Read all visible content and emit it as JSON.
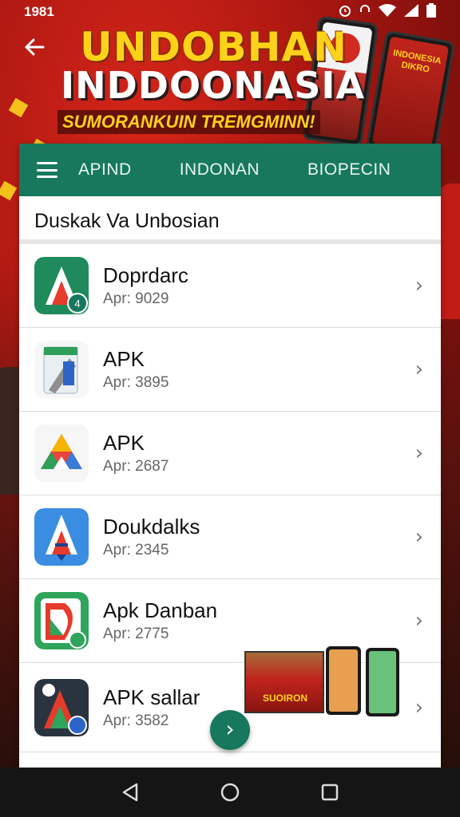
{
  "status_bar": {
    "time": "1981",
    "icons": [
      "alarm-icon",
      "headset-icon",
      "wifi-icon",
      "signal-icon",
      "battery-icon"
    ]
  },
  "banner": {
    "title_line1": "UNDOBHAN",
    "title_line2": "INDDOONASIA",
    "subtitle": "SUMORANKUIN TREMGMINN!",
    "promo_phone_text": "INDONESIA DIKRO"
  },
  "tabs": {
    "menu_icon": "hamburger-icon",
    "items": [
      "APIND",
      "INDONAN",
      "BIOPECIN"
    ]
  },
  "section": {
    "title": "Duskak Va Unbosian"
  },
  "apps": [
    {
      "name": "Doprdarc",
      "version": "Apr: 9029",
      "icon": "green-a-icon"
    },
    {
      "name": "APK",
      "version": "Apr: 3895",
      "icon": "package-icon"
    },
    {
      "name": "APK",
      "version": "Apr: 2687",
      "icon": "drive-icon"
    },
    {
      "name": "Doukdalks",
      "version": "Apr: 2345",
      "icon": "blue-a-icon"
    },
    {
      "name": "Apk Danban",
      "version": "Apr: 2775",
      "icon": "play-d-icon"
    },
    {
      "name": "APK sallar",
      "version": "Apr: 3582",
      "icon": "dark-a-icon"
    }
  ],
  "promo": {
    "label": "SUOIRON"
  },
  "fab": {
    "icon": "chevron-right-icon"
  },
  "navbar": {
    "items": [
      "back-triangle-icon",
      "home-circle-icon",
      "recents-square-icon"
    ]
  },
  "colors": {
    "accent": "#17785d",
    "banner_red": "#c21c16",
    "banner_yellow": "#ffd21a"
  }
}
